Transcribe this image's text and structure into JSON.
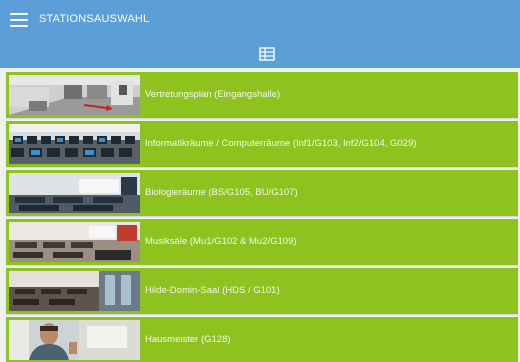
{
  "appbar": {
    "title": "STATIONSAUSWAHL",
    "menu_icon": "hamburger-menu-icon",
    "view_icon": "table-view-icon",
    "color": "#5b9ed8"
  },
  "stations": [
    {
      "label": "Vertretungsplan (Eingangshalle)",
      "thumb": "hallway-photo"
    },
    {
      "label": "Informatikräume / Computerräume (Inf1/G103, Inf2/G104, G029)",
      "thumb": "computer-lab-photo"
    },
    {
      "label": "Biologieräume (BS/G105, BU/G107)",
      "thumb": "biology-room-photo"
    },
    {
      "label": "Musiksäle (Mu1/G102 & Mu2/G109)",
      "thumb": "music-room-photo"
    },
    {
      "label": "Hilde-Domin-Saal (HDS / G101)",
      "thumb": "hall-photo"
    },
    {
      "label": "Hausmeister (G128)",
      "thumb": "caretaker-photo"
    }
  ],
  "accent_color": "#8dc21f"
}
